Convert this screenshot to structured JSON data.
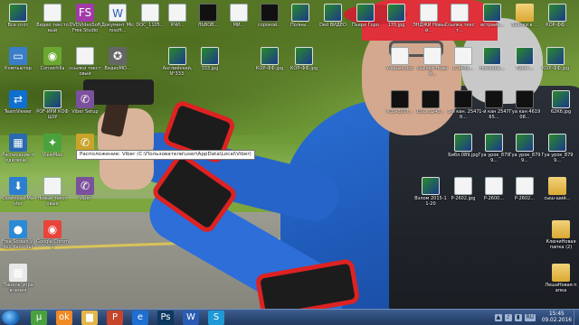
{
  "tooltip": "Расположение: Viber (C:\\Пользователи\\user\\AppData\\Local\\Viber)",
  "desktop_icons": [
    {
      "label": "Все спот",
      "glyph": "g-img",
      "text": "",
      "color": "#2a5"
    },
    {
      "label": "Видео текстовый",
      "glyph": "g-doc",
      "text": "",
      "color": "#fff"
    },
    {
      "label": "DVDVideoSoft Free Studio",
      "glyph": "g-app",
      "text": "FS",
      "color": "#a23aa8"
    },
    {
      "label": "Документ Microsoft...",
      "glyph": "g-doc",
      "text": "W",
      "color": "#2b5cb3"
    },
    {
      "label": "DOC_1105...",
      "glyph": "g-doc",
      "text": "",
      "color": "#fff"
    },
    {
      "label": "Компьютер",
      "glyph": "g-app",
      "text": "▭",
      "color": "#3a7dc9"
    },
    {
      "label": "Convertilla",
      "glyph": "g-app",
      "text": "◉",
      "color": "#6aa832"
    },
    {
      "label": "ссылки текстовый",
      "glyph": "g-doc",
      "text": "",
      "color": "#fff"
    },
    {
      "label": "ВидеоМО...",
      "glyph": "g-app",
      "text": "✪",
      "color": "#666"
    },
    {
      "label": "TeamViewer",
      "glyph": "g-app",
      "text": "⇄",
      "color": "#0e6fd0"
    },
    {
      "label": "POF-ИРИ КОФ ЦОР",
      "glyph": "g-img",
      "text": "",
      "color": "#333"
    },
    {
      "label": "Viber Setup",
      "glyph": "g-app",
      "text": "✆",
      "color": "#7b519d"
    },
    {
      "label": "Расписание подключе...",
      "glyph": "g-app",
      "text": "▦",
      "color": "#2a6ab0"
    },
    {
      "label": "ViewMax",
      "glyph": "g-app",
      "text": "✦",
      "color": "#4aa23f"
    },
    {
      "label": "Viber",
      "glyph": "g-app",
      "text": "✆",
      "color": "#c9a32a"
    },
    {
      "label": "Download Master",
      "glyph": "g-app",
      "text": "⬇",
      "color": "#2c7fd0"
    },
    {
      "label": "Новый текстовый",
      "glyph": "g-doc",
      "text": "",
      "color": "#fff"
    },
    {
      "label": "Viber",
      "glyph": "g-app",
      "text": "✆",
      "color": "#7b519d"
    },
    {
      "label": "Free Screen Video Recorder",
      "glyph": "g-app",
      "text": "●",
      "color": "#2a8ad6"
    },
    {
      "label": "Google Chrome",
      "glyph": "g-app",
      "text": "◉",
      "color": "#e8443a"
    },
    {
      "label": "Панель управления",
      "glyph": "g-app",
      "text": "▦",
      "color": "#e8e8e8"
    }
  ],
  "upper_icons": [
    {
      "label": "ЯЧИ...",
      "glyph": "g-doc",
      "text": "",
      "color": "#fff"
    },
    {
      "label": "ЛЬВОВ...",
      "glyph": "g-vid",
      "text": "",
      "color": "#111"
    },
    {
      "label": "МИ...",
      "glyph": "g-doc",
      "text": "",
      "color": "#fff"
    },
    {
      "label": "сорокой...",
      "glyph": "g-vid",
      "text": "",
      "color": "#111"
    },
    {
      "label": "Полны...",
      "glyph": "g-img",
      "text": "",
      "color": "#a22"
    },
    {
      "label": "Ded ВИДЕО",
      "glyph": "g-img",
      "text": "",
      "color": "#a22"
    },
    {
      "label": "Пьеро Горо",
      "glyph": "g-img",
      "text": "",
      "color": "#a22"
    },
    {
      "label": "170.jpg",
      "glyph": "g-img",
      "text": "",
      "color": "#c83"
    },
    {
      "label": "ЭНДЖИ Новый...",
      "glyph": "g-doc",
      "text": "",
      "color": "#fff"
    },
    {
      "label": "Ссылка текст...",
      "glyph": "g-doc",
      "text": "",
      "color": "#fff"
    },
    {
      "label": "встраив...",
      "glyph": "g-img",
      "text": "",
      "color": "#c83"
    },
    {
      "label": "Значки в ...",
      "glyph": "g-folder",
      "text": "",
      "color": "#e3b64a"
    },
    {
      "label": "КОР-ФФ...",
      "glyph": "g-img",
      "text": "",
      "color": "#336"
    },
    {
      "label": "Библ.089...",
      "glyph": "g-img",
      "text": "",
      "color": "#336"
    }
  ],
  "mid_icons": [
    {
      "label": "Английский, N°333.",
      "glyph": "g-img",
      "text": "",
      "color": "#224"
    },
    {
      "label": "333.jpg",
      "glyph": "g-img",
      "text": "",
      "color": "#224"
    },
    {
      "label": "КОР-ФФ.jpg",
      "glyph": "g-img",
      "text": "",
      "color": "#336"
    },
    {
      "label": "КОР-ФФ.jpg",
      "glyph": "g-img",
      "text": "",
      "color": "#336"
    },
    {
      "label": "Учёные.doc",
      "glyph": "g-doc",
      "text": "",
      "color": "#fff"
    },
    {
      "label": "ссылки Новый...",
      "glyph": "g-doc",
      "text": "",
      "color": "#fff"
    },
    {
      "label": "6 1445...",
      "glyph": "g-doc",
      "text": "",
      "color": "#fff"
    },
    {
      "label": "Нонкопе...",
      "glyph": "g-img",
      "text": "",
      "color": "#336"
    },
    {
      "label": "Текст...",
      "glyph": "g-img",
      "text": "",
      "color": "#336"
    },
    {
      "label": "КОР-ФФ.jpg",
      "glyph": "g-img",
      "text": "",
      "color": "#336"
    },
    {
      "label": "62Кб.jpg",
      "glyph": "g-img",
      "text": "",
      "color": "#336"
    }
  ],
  "right_icons": [
    {
      "label": "POS-2007...",
      "glyph": "g-vid",
      "text": "",
      "color": "#111"
    },
    {
      "label": "DSC_0240...",
      "glyph": "g-vid",
      "text": "",
      "color": "#111"
    },
    {
      "label": "1-й кан. 2547б...",
      "glyph": "g-vid",
      "text": "",
      "color": "#111"
    },
    {
      "label": "1-й кан 254765...",
      "glyph": "g-vid",
      "text": "",
      "color": "#111"
    },
    {
      "label": "Гуа кан 461908...",
      "glyph": "g-vid",
      "text": "",
      "color": "#111"
    },
    {
      "label": "NNMO-9...",
      "glyph": "g-vid",
      "text": "",
      "color": "#111"
    },
    {
      "label": "Библ.089.jpg",
      "glyph": "g-img",
      "text": "",
      "color": "#336"
    },
    {
      "label": "Гуа урок_8799...",
      "glyph": "g-img",
      "text": "",
      "color": "#336"
    },
    {
      "label": "Гуа урок_8799...",
      "glyph": "g-img",
      "text": "",
      "color": "#336"
    },
    {
      "label": "Гуа урок_8799...",
      "glyph": "g-img",
      "text": "",
      "color": "#336"
    },
    {
      "label": "Взлом 2015-11-20",
      "glyph": "g-img",
      "text": "",
      "color": "#336"
    },
    {
      "label": "P-2602.jpg",
      "glyph": "g-doc",
      "text": "",
      "color": "#fff"
    },
    {
      "label": "P-2600...",
      "glyph": "g-doc",
      "text": "",
      "color": "#fff"
    },
    {
      "label": "P-2602...",
      "glyph": "g-doc",
      "text": "",
      "color": "#fff"
    },
    {
      "label": "сыш-ший...",
      "glyph": "g-folder",
      "text": "",
      "color": "#e3b64a"
    },
    {
      "label": "КлючиНовая папка (2)",
      "glyph": "g-folder",
      "text": "",
      "color": "#e3b64a"
    },
    {
      "label": "ЛешаНовая папка",
      "glyph": "g-folder",
      "text": "",
      "color": "#e3b64a"
    },
    {
      "label": "Корзина",
      "glyph": "g-bin",
      "text": "",
      "color": "#ccd"
    }
  ],
  "taskbar": {
    "apps": [
      {
        "name": "uTorrent",
        "text": "µ",
        "color": "#4aa23f"
      },
      {
        "name": "Odnoklassniki",
        "text": "ok",
        "color": "#f08a24"
      },
      {
        "name": "Explorer",
        "text": "▆",
        "color": "#e3b64a"
      },
      {
        "name": "PowerPoint",
        "text": "P",
        "color": "#c8442a"
      },
      {
        "name": "Internet Explorer",
        "text": "e",
        "color": "#1e6fd0"
      },
      {
        "name": "Photoshop",
        "text": "Ps",
        "color": "#0d3860"
      },
      {
        "name": "Word",
        "text": "W",
        "color": "#2b5cb3"
      },
      {
        "name": "Skype",
        "text": "S",
        "color": "#1e9ad6"
      }
    ],
    "time": "15:45",
    "date": "09.02.2016",
    "lang": "RU"
  }
}
